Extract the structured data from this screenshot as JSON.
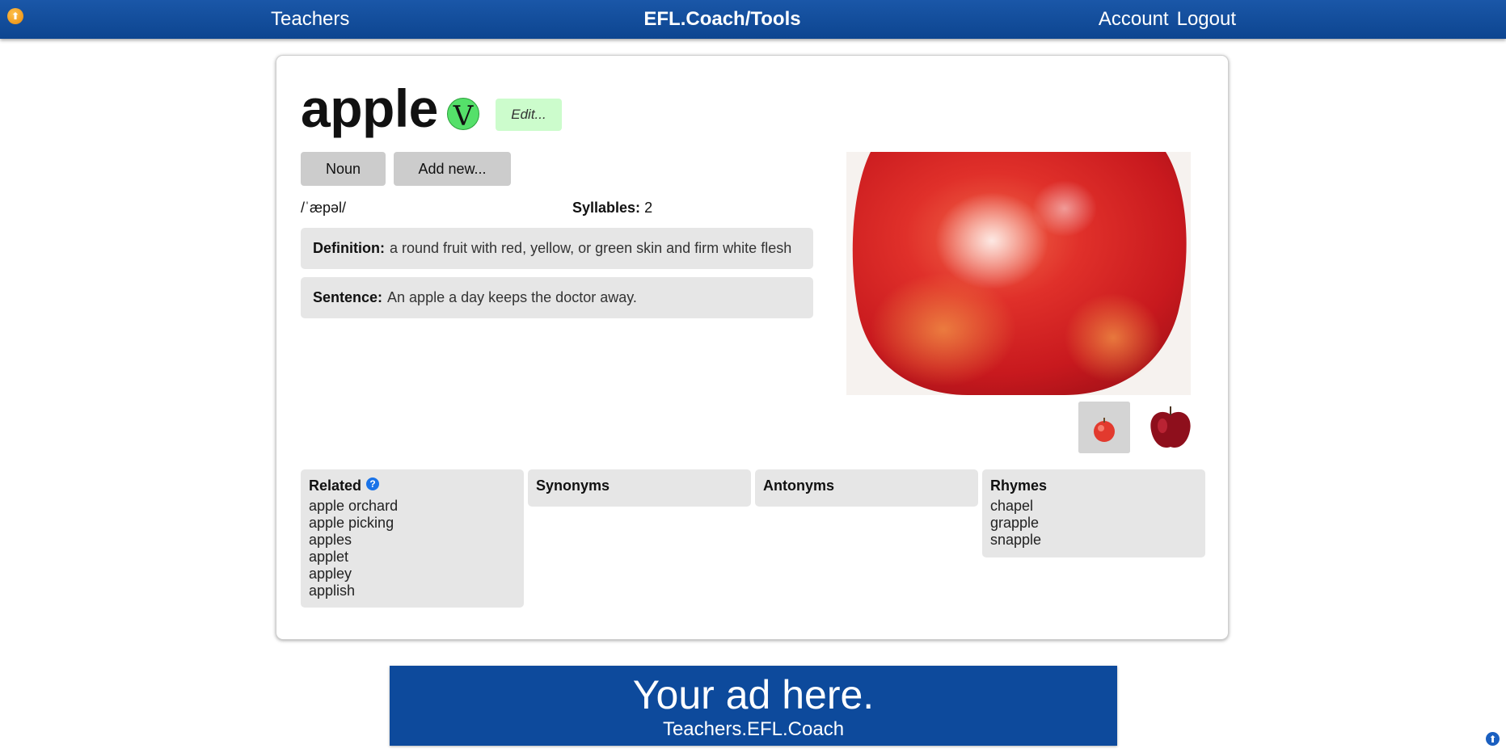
{
  "nav": {
    "orb_icon": "up-arrow-icon",
    "teachers": "Teachers",
    "brand": "EFL.Coach/Tools",
    "account": "Account",
    "logout": "Logout"
  },
  "word": {
    "title": "apple",
    "badge": "V",
    "edit": "Edit...",
    "pos_buttons": [
      "Noun",
      "Add new..."
    ],
    "ipa": "/ˈæpəl/",
    "syllables_label": "Syllables:",
    "syllables_value": "2",
    "definition_label": "Definition:",
    "definition": "a round fruit with red, yellow, or green skin and firm white flesh",
    "sentence_label": "Sentence:",
    "sentence": "An apple a day keeps the doctor away."
  },
  "lists": {
    "related": {
      "title": "Related",
      "items": [
        "apple orchard",
        "apple picking",
        "apples",
        "applet",
        "appley",
        "applish"
      ]
    },
    "synonyms": {
      "title": "Synonyms",
      "items": []
    },
    "antonyms": {
      "title": "Antonyms",
      "items": []
    },
    "rhymes": {
      "title": "Rhymes",
      "items": [
        "chapel",
        "grapple",
        "snapple"
      ]
    }
  },
  "ad": {
    "title": "Your ad here.",
    "subtitle": "Teachers.EFL.Coach"
  },
  "colors": {
    "nav_bg": "#0d4590",
    "badge_green": "#55e06a",
    "edit_bg": "#ccfccc",
    "box_bg": "#e6e6e6",
    "ad_bg": "#0d4a9c"
  }
}
